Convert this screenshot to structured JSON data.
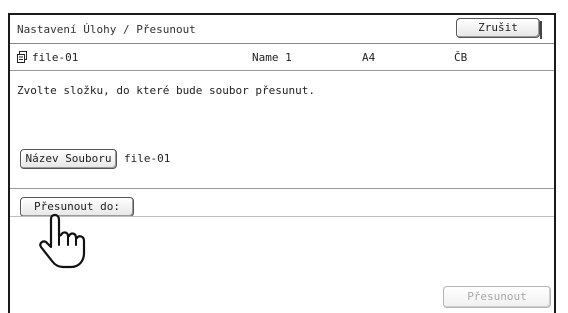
{
  "header": {
    "title": "Nastavení Úlohy / Přesunout",
    "cancel_label": "Zrušit"
  },
  "file_row": {
    "icon": "file-icon",
    "name": "file-01",
    "user": "Name 1",
    "paper_size": "A4",
    "color_mode": "ČB"
  },
  "instruction": "Zvolte složku, do které bude soubor přesunut.",
  "file_name": {
    "button_label": "Název Souboru",
    "value": "file-01"
  },
  "move_to": {
    "button_label": "Přesunout do:"
  },
  "footer": {
    "move_label": "Přesunout"
  }
}
